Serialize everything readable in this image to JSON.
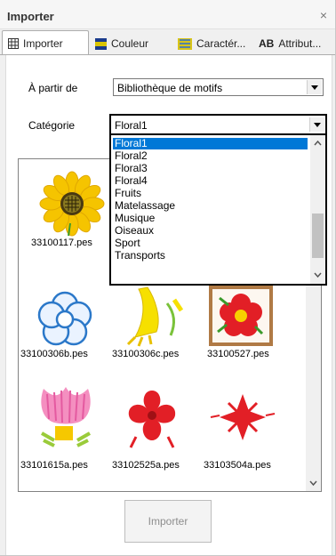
{
  "window": {
    "title": "Importer",
    "close_glyph": "×"
  },
  "tabs": [
    {
      "label": "Importer",
      "icon": "grid-icon",
      "active": true
    },
    {
      "label": "Couleur",
      "icon": "color-icon",
      "active": false
    },
    {
      "label": "Caractér...",
      "icon": "character-icon",
      "active": false
    },
    {
      "label": "Attribut...",
      "icon_text": "AB",
      "active": false
    }
  ],
  "source": {
    "label": "À partir de",
    "value": "Bibliothèque de motifs"
  },
  "category": {
    "label": "Catégorie",
    "value": "Floral1",
    "options": [
      "Floral1",
      "Floral2",
      "Floral3",
      "Floral4",
      "Fruits",
      "Matelassage",
      "Musique",
      "Oiseaux",
      "Sport",
      "Transports"
    ],
    "selected_index": 0
  },
  "gallery": {
    "items": [
      {
        "file": "33100117.pes",
        "icon": "sunflower-icon"
      },
      {
        "file": "33100306b.pes",
        "icon": "blue-flower-outline-icon"
      },
      {
        "file": "33100306c.pes",
        "icon": "yellow-bell-flower-icon"
      },
      {
        "file": "33100527.pes",
        "icon": "framed-red-flower-icon"
      },
      {
        "file": "33101615a.pes",
        "icon": "pink-tulip-icon"
      },
      {
        "file": "33102525a.pes",
        "icon": "red-flower-icon"
      },
      {
        "file": "33103504a.pes",
        "icon": "red-star-flower-icon"
      }
    ]
  },
  "import_button": {
    "label": "Importer",
    "enabled": false
  },
  "colors": {
    "selection": "#0078d7"
  }
}
